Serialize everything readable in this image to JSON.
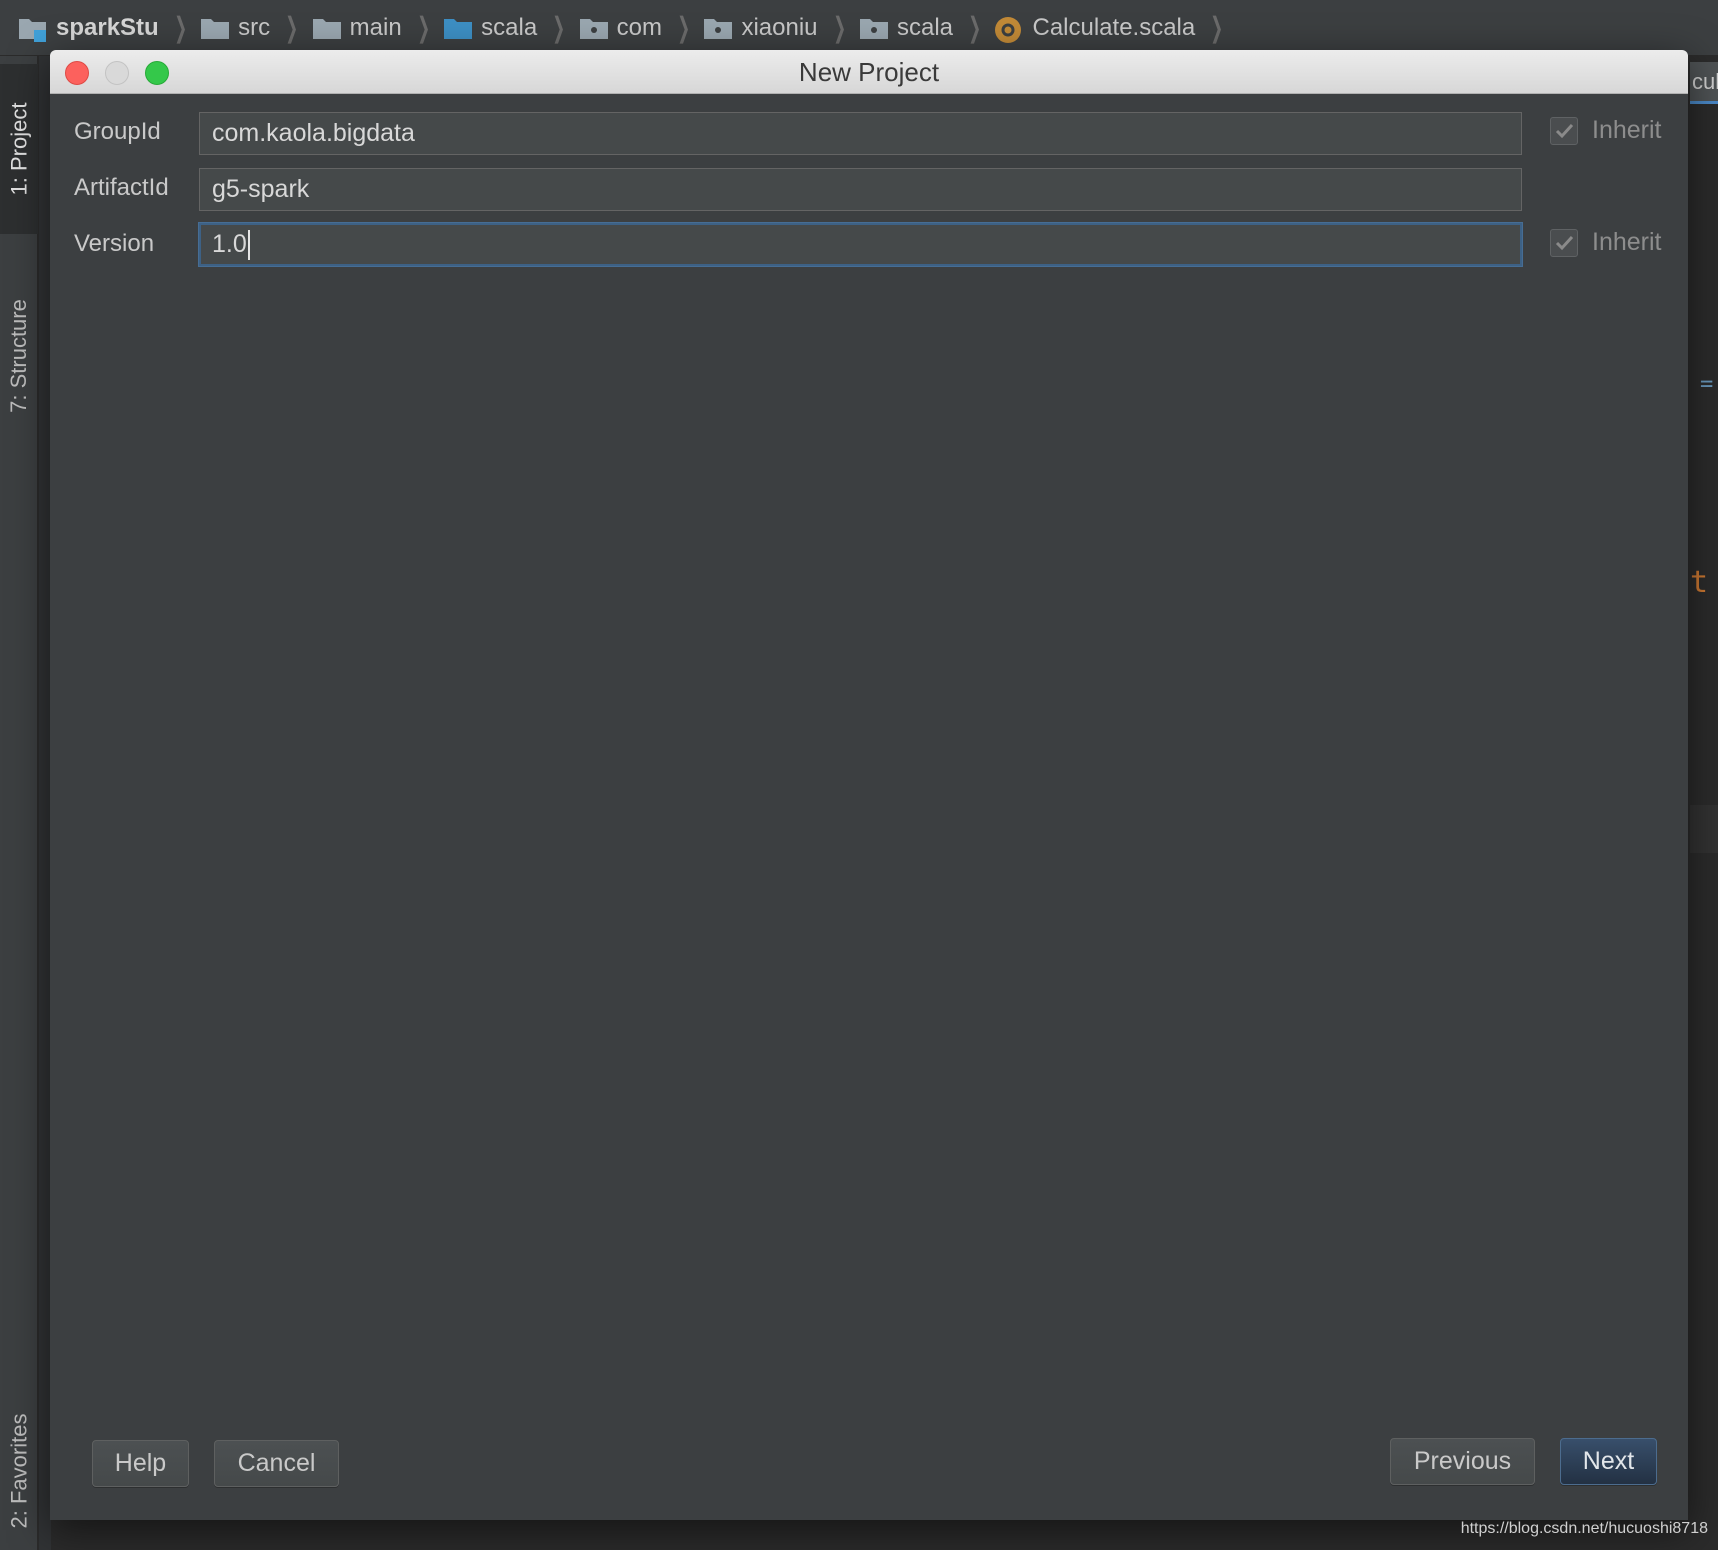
{
  "breadcrumbs": [
    {
      "label": "sparkStu",
      "icon": "project-folder-icon"
    },
    {
      "label": "src",
      "icon": "folder-icon"
    },
    {
      "label": "main",
      "icon": "folder-icon"
    },
    {
      "label": "scala",
      "icon": "source-folder-icon"
    },
    {
      "label": "com",
      "icon": "package-icon"
    },
    {
      "label": "xiaoniu",
      "icon": "package-icon"
    },
    {
      "label": "scala",
      "icon": "package-icon"
    },
    {
      "label": "Calculate.scala",
      "icon": "scala-object-icon"
    }
  ],
  "tool_strip": {
    "project": "1: Project",
    "structure": "7: Structure",
    "favorites": "2: Favorites"
  },
  "editor_fragments": {
    "tab": "cula",
    "code": "t"
  },
  "dialog": {
    "title": "New Project",
    "fields": {
      "group_id": {
        "label": "GroupId",
        "value": "com.kaola.bigdata",
        "inherit_label": "Inherit",
        "inherit_checked": true
      },
      "artifact_id": {
        "label": "ArtifactId",
        "value": "g5-spark"
      },
      "version": {
        "label": "Version",
        "value": "1.0",
        "inherit_label": "Inherit",
        "inherit_checked": true
      }
    },
    "buttons": {
      "help": "Help",
      "cancel": "Cancel",
      "previous": "Previous",
      "next": "Next"
    }
  },
  "watermark": "https://blog.csdn.net/hucuoshi8718",
  "colors": {
    "background": "#2b2b2b",
    "dialog_background": "#3c3f41",
    "field_background": "#45494a",
    "focus_border": "#3d6185",
    "primary_button": "#2c3e55",
    "close_button": "#fc615d",
    "maximize_button": "#34c84a"
  }
}
